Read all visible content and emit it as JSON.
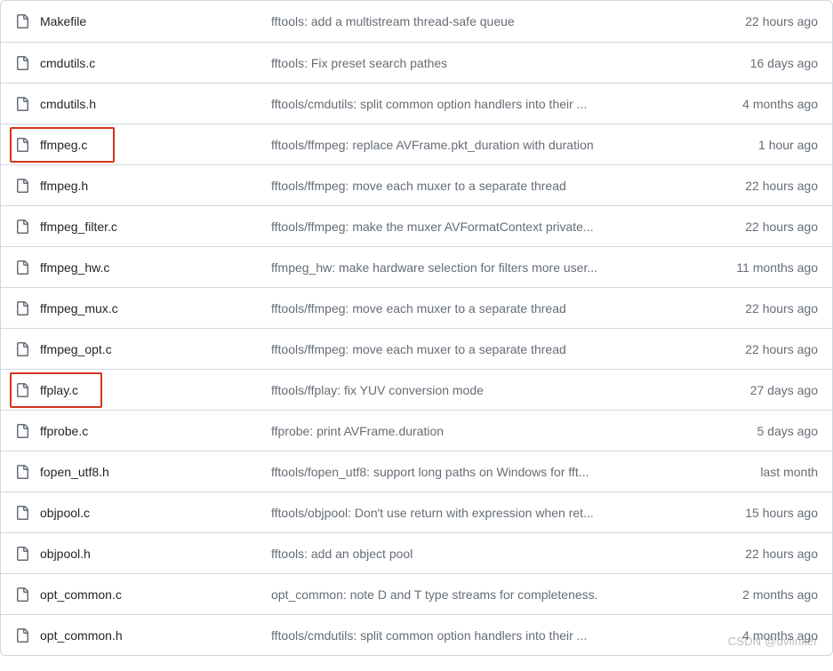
{
  "watermark": "CSDN @dvlinker",
  "files": [
    {
      "name": "Makefile",
      "message": "fftools: add a multistream thread-safe queue",
      "time": "22 hours ago",
      "highlighted": false
    },
    {
      "name": "cmdutils.c",
      "message": "fftools: Fix preset search pathes",
      "time": "16 days ago",
      "highlighted": false
    },
    {
      "name": "cmdutils.h",
      "message": "fftools/cmdutils: split common option handlers into their ...",
      "time": "4 months ago",
      "highlighted": false
    },
    {
      "name": "ffmpeg.c",
      "message": "fftools/ffmpeg: replace AVFrame.pkt_duration with duration",
      "time": "1 hour ago",
      "highlighted": true,
      "highlight_width": 118
    },
    {
      "name": "ffmpeg.h",
      "message": "fftools/ffmpeg: move each muxer to a separate thread",
      "time": "22 hours ago",
      "highlighted": false
    },
    {
      "name": "ffmpeg_filter.c",
      "message": "fftools/ffmpeg: make the muxer AVFormatContext private...",
      "time": "22 hours ago",
      "highlighted": false
    },
    {
      "name": "ffmpeg_hw.c",
      "message": "ffmpeg_hw: make hardware selection for filters more user...",
      "time": "11 months ago",
      "highlighted": false
    },
    {
      "name": "ffmpeg_mux.c",
      "message": "fftools/ffmpeg: move each muxer to a separate thread",
      "time": "22 hours ago",
      "highlighted": false
    },
    {
      "name": "ffmpeg_opt.c",
      "message": "fftools/ffmpeg: move each muxer to a separate thread",
      "time": "22 hours ago",
      "highlighted": false
    },
    {
      "name": "ffplay.c",
      "message": "fftools/ffplay: fix YUV conversion mode",
      "time": "27 days ago",
      "highlighted": true,
      "highlight_width": 104
    },
    {
      "name": "ffprobe.c",
      "message": "ffprobe: print AVFrame.duration",
      "time": "5 days ago",
      "highlighted": false
    },
    {
      "name": "fopen_utf8.h",
      "message": "fftools/fopen_utf8: support long paths on Windows for fft...",
      "time": "last month",
      "highlighted": false
    },
    {
      "name": "objpool.c",
      "message": "fftools/objpool: Don't use return with expression when ret...",
      "time": "15 hours ago",
      "highlighted": false
    },
    {
      "name": "objpool.h",
      "message": "fftools: add an object pool",
      "time": "22 hours ago",
      "highlighted": false
    },
    {
      "name": "opt_common.c",
      "message": "opt_common: note D and T type streams for completeness.",
      "time": "2 months ago",
      "highlighted": false
    },
    {
      "name": "opt_common.h",
      "message": "fftools/cmdutils: split common option handlers into their ...",
      "time": "4 months ago",
      "highlighted": false
    }
  ]
}
